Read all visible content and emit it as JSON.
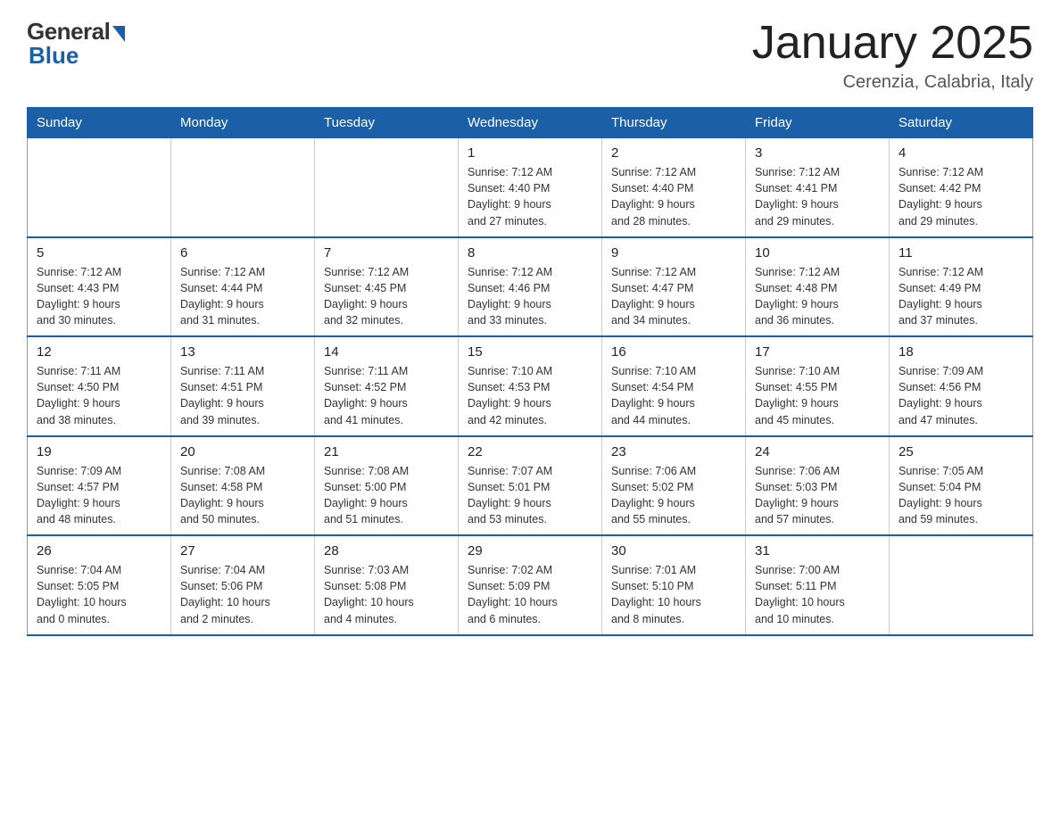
{
  "logo": {
    "general": "General",
    "blue": "Blue"
  },
  "title": "January 2025",
  "location": "Cerenzia, Calabria, Italy",
  "days_of_week": [
    "Sunday",
    "Monday",
    "Tuesday",
    "Wednesday",
    "Thursday",
    "Friday",
    "Saturday"
  ],
  "weeks": [
    [
      {
        "day": "",
        "info": ""
      },
      {
        "day": "",
        "info": ""
      },
      {
        "day": "",
        "info": ""
      },
      {
        "day": "1",
        "info": "Sunrise: 7:12 AM\nSunset: 4:40 PM\nDaylight: 9 hours\nand 27 minutes."
      },
      {
        "day": "2",
        "info": "Sunrise: 7:12 AM\nSunset: 4:40 PM\nDaylight: 9 hours\nand 28 minutes."
      },
      {
        "day": "3",
        "info": "Sunrise: 7:12 AM\nSunset: 4:41 PM\nDaylight: 9 hours\nand 29 minutes."
      },
      {
        "day": "4",
        "info": "Sunrise: 7:12 AM\nSunset: 4:42 PM\nDaylight: 9 hours\nand 29 minutes."
      }
    ],
    [
      {
        "day": "5",
        "info": "Sunrise: 7:12 AM\nSunset: 4:43 PM\nDaylight: 9 hours\nand 30 minutes."
      },
      {
        "day": "6",
        "info": "Sunrise: 7:12 AM\nSunset: 4:44 PM\nDaylight: 9 hours\nand 31 minutes."
      },
      {
        "day": "7",
        "info": "Sunrise: 7:12 AM\nSunset: 4:45 PM\nDaylight: 9 hours\nand 32 minutes."
      },
      {
        "day": "8",
        "info": "Sunrise: 7:12 AM\nSunset: 4:46 PM\nDaylight: 9 hours\nand 33 minutes."
      },
      {
        "day": "9",
        "info": "Sunrise: 7:12 AM\nSunset: 4:47 PM\nDaylight: 9 hours\nand 34 minutes."
      },
      {
        "day": "10",
        "info": "Sunrise: 7:12 AM\nSunset: 4:48 PM\nDaylight: 9 hours\nand 36 minutes."
      },
      {
        "day": "11",
        "info": "Sunrise: 7:12 AM\nSunset: 4:49 PM\nDaylight: 9 hours\nand 37 minutes."
      }
    ],
    [
      {
        "day": "12",
        "info": "Sunrise: 7:11 AM\nSunset: 4:50 PM\nDaylight: 9 hours\nand 38 minutes."
      },
      {
        "day": "13",
        "info": "Sunrise: 7:11 AM\nSunset: 4:51 PM\nDaylight: 9 hours\nand 39 minutes."
      },
      {
        "day": "14",
        "info": "Sunrise: 7:11 AM\nSunset: 4:52 PM\nDaylight: 9 hours\nand 41 minutes."
      },
      {
        "day": "15",
        "info": "Sunrise: 7:10 AM\nSunset: 4:53 PM\nDaylight: 9 hours\nand 42 minutes."
      },
      {
        "day": "16",
        "info": "Sunrise: 7:10 AM\nSunset: 4:54 PM\nDaylight: 9 hours\nand 44 minutes."
      },
      {
        "day": "17",
        "info": "Sunrise: 7:10 AM\nSunset: 4:55 PM\nDaylight: 9 hours\nand 45 minutes."
      },
      {
        "day": "18",
        "info": "Sunrise: 7:09 AM\nSunset: 4:56 PM\nDaylight: 9 hours\nand 47 minutes."
      }
    ],
    [
      {
        "day": "19",
        "info": "Sunrise: 7:09 AM\nSunset: 4:57 PM\nDaylight: 9 hours\nand 48 minutes."
      },
      {
        "day": "20",
        "info": "Sunrise: 7:08 AM\nSunset: 4:58 PM\nDaylight: 9 hours\nand 50 minutes."
      },
      {
        "day": "21",
        "info": "Sunrise: 7:08 AM\nSunset: 5:00 PM\nDaylight: 9 hours\nand 51 minutes."
      },
      {
        "day": "22",
        "info": "Sunrise: 7:07 AM\nSunset: 5:01 PM\nDaylight: 9 hours\nand 53 minutes."
      },
      {
        "day": "23",
        "info": "Sunrise: 7:06 AM\nSunset: 5:02 PM\nDaylight: 9 hours\nand 55 minutes."
      },
      {
        "day": "24",
        "info": "Sunrise: 7:06 AM\nSunset: 5:03 PM\nDaylight: 9 hours\nand 57 minutes."
      },
      {
        "day": "25",
        "info": "Sunrise: 7:05 AM\nSunset: 5:04 PM\nDaylight: 9 hours\nand 59 minutes."
      }
    ],
    [
      {
        "day": "26",
        "info": "Sunrise: 7:04 AM\nSunset: 5:05 PM\nDaylight: 10 hours\nand 0 minutes."
      },
      {
        "day": "27",
        "info": "Sunrise: 7:04 AM\nSunset: 5:06 PM\nDaylight: 10 hours\nand 2 minutes."
      },
      {
        "day": "28",
        "info": "Sunrise: 7:03 AM\nSunset: 5:08 PM\nDaylight: 10 hours\nand 4 minutes."
      },
      {
        "day": "29",
        "info": "Sunrise: 7:02 AM\nSunset: 5:09 PM\nDaylight: 10 hours\nand 6 minutes."
      },
      {
        "day": "30",
        "info": "Sunrise: 7:01 AM\nSunset: 5:10 PM\nDaylight: 10 hours\nand 8 minutes."
      },
      {
        "day": "31",
        "info": "Sunrise: 7:00 AM\nSunset: 5:11 PM\nDaylight: 10 hours\nand 10 minutes."
      },
      {
        "day": "",
        "info": ""
      }
    ]
  ]
}
